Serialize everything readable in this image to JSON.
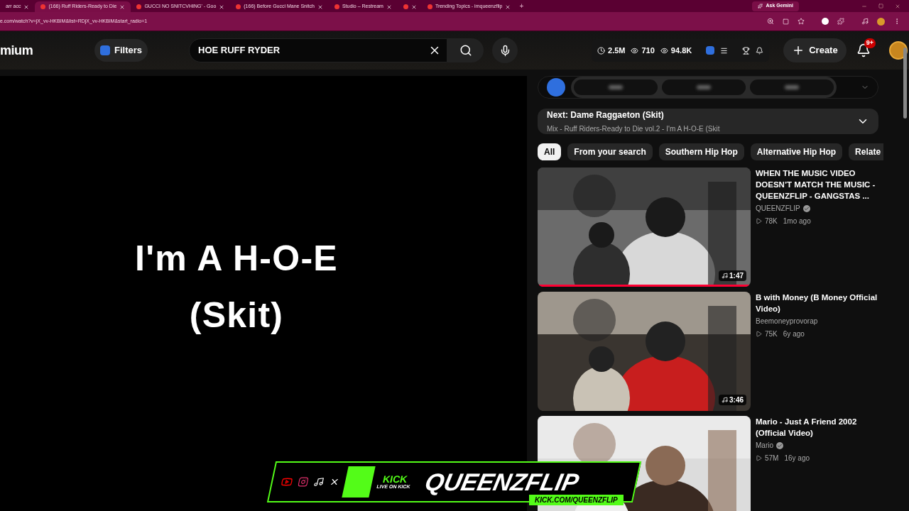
{
  "browser": {
    "tabs": [
      {
        "title": "arr acc",
        "selected": false
      },
      {
        "title": "(166) Ruff Riders-Ready to Die",
        "selected": true
      },
      {
        "title": "GUCCI NO SNITCVHING' - Goo",
        "selected": false
      },
      {
        "title": "(166) Before Gucci Mane Snitch",
        "selected": false
      },
      {
        "title": "Studio – Restream",
        "selected": false
      },
      {
        "selected": false
      },
      {
        "title": "Trending Topics - imqueenzflip",
        "selected": false
      }
    ],
    "new_tab": "+",
    "ask_gemini": "Ask Gemini",
    "url": "e.com/watch?v=jX_vv-HKBIM&list=RDjX_vv-HKBIM&start_radio=1"
  },
  "header": {
    "logo": "mium",
    "filters": "Filters",
    "search": {
      "value": "HOE RUFF RYDER"
    },
    "stats": [
      "2.5M",
      "710",
      "94.8K"
    ],
    "create": "Create",
    "notifications": "9+"
  },
  "player": {
    "caption_lines": [
      "I'm A H-O-E",
      "(Skit)"
    ]
  },
  "queue": {
    "next": "Next: Dame Raggaeton (Skit)",
    "playlist": "Mix - Ruff Riders-Ready to Die vol.2 - I'm A H-O-E (Skit"
  },
  "chips": [
    {
      "label": "All",
      "selected": true
    },
    {
      "label": "From your search",
      "selected": false
    },
    {
      "label": "Southern Hip Hop",
      "selected": false
    },
    {
      "label": "Alternative Hip Hop",
      "selected": false
    },
    {
      "label": "Relate",
      "selected": false
    }
  ],
  "videos": [
    {
      "title": "WHEN THE MUSIC VIDEO DOESN’T MATCH THE MUSIC - QUEENZFLIP - GANGSTAS ...",
      "channel": "QUEENZFLIP",
      "verified": true,
      "views": "78K",
      "age": "1mo ago",
      "duration": "1:47",
      "level": 1
    },
    {
      "title": "B with Money (B Money Official Video)",
      "channel": "Beemoneyprovorap",
      "verified": false,
      "views": "75K",
      "age": "6y ago",
      "duration": "3:46"
    },
    {
      "title": "Mario - Just A Friend 2002 (Official Video)",
      "channel": "Mario",
      "verified": true,
      "views": "57M",
      "age": "16y ago"
    }
  ],
  "overlay": {
    "brand": "KICK",
    "tagline": "LIVE ON KICK",
    "name": "QUEENZFLIP",
    "url": "KICK.COM/QUEENZFLIP"
  }
}
